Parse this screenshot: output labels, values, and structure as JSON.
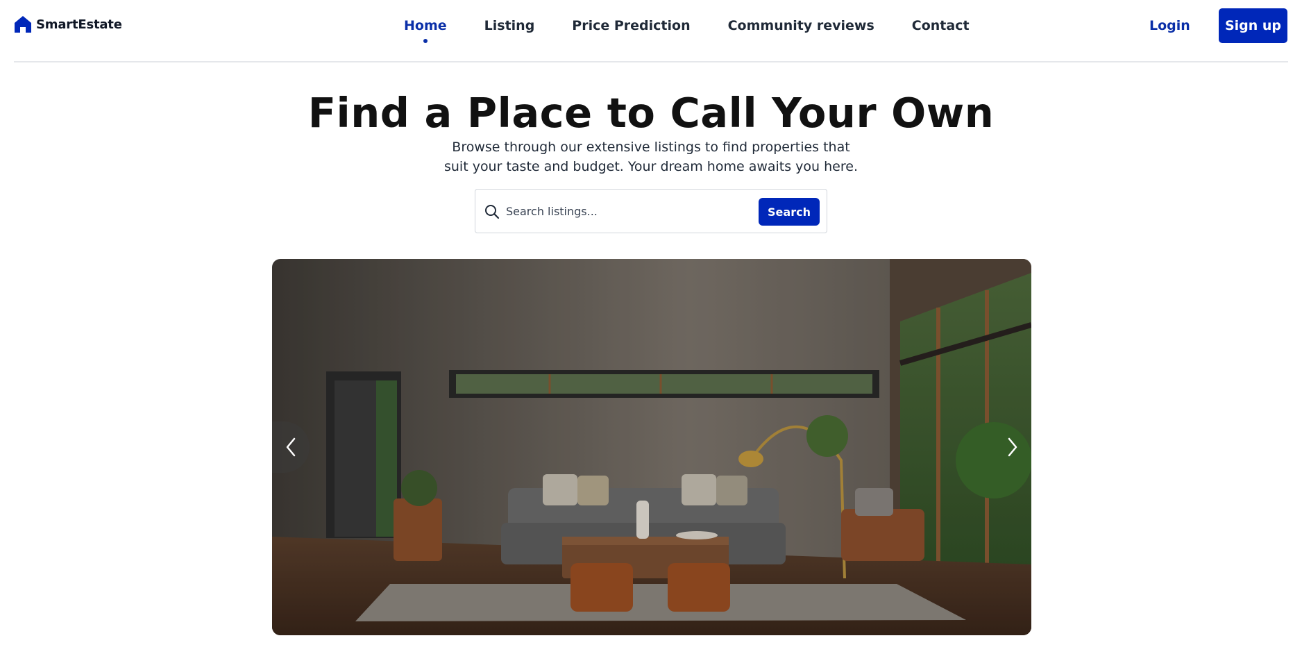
{
  "brand": {
    "name": "SmartEstate",
    "icon": "house-icon"
  },
  "nav": {
    "items": [
      {
        "label": "Home",
        "active": true
      },
      {
        "label": "Listing",
        "active": false
      },
      {
        "label": "Price Prediction",
        "active": false
      },
      {
        "label": "Community reviews",
        "active": false
      },
      {
        "label": "Contact",
        "active": false
      }
    ]
  },
  "auth": {
    "login_label": "Login",
    "signup_label": "Sign up"
  },
  "hero": {
    "title": "Find a Place to Call Your Own",
    "subtitle": "Browse through our extensive listings to find properties that suit your taste and budget. Your dream home awaits you here."
  },
  "search": {
    "placeholder": "Search listings...",
    "value": "",
    "button_label": "Search",
    "icon": "search-icon"
  },
  "carousel": {
    "image": "living-room-interior-photo",
    "prev_icon": "chevron-left-icon",
    "next_icon": "chevron-right-icon"
  },
  "colors": {
    "accent": "#0027b9",
    "nav_active": "#0a2fa8",
    "text": "#111827",
    "divider": "#e5e7eb"
  }
}
